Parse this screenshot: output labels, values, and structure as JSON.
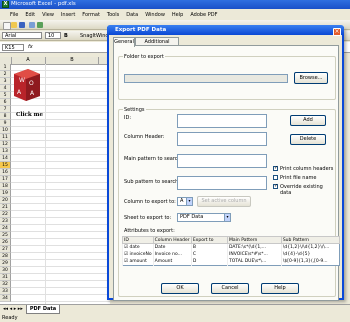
{
  "app": {
    "title": "Microsoft Excel - pdf.xls"
  },
  "menu": [
    "File",
    "Edit",
    "View",
    "Insert",
    "Format",
    "Tools",
    "Data",
    "Window",
    "Help",
    "Adobe PDF"
  ],
  "toolbar": {
    "font": "Arial",
    "size": "10",
    "snagit": "SnagIt",
    "window": "Window"
  },
  "namebox": "K15",
  "columns": [
    "A",
    "B"
  ],
  "rows": [
    "1",
    "2",
    "3",
    "4",
    "5",
    "6",
    "7",
    "8",
    "9",
    "10",
    "11",
    "12",
    "13",
    "14",
    "15",
    "16",
    "17",
    "18",
    "19",
    "20",
    "21",
    "22",
    "23",
    "24",
    "25",
    "26",
    "27",
    "28",
    "29",
    "30",
    "31",
    "32",
    "33",
    "34"
  ],
  "logo": {
    "letters": [
      "W",
      "O",
      "A",
      "A"
    ]
  },
  "clickme": "Click me",
  "sheet_tab": "PDF Data",
  "status": "Ready",
  "dialog": {
    "title": "Export PDF Data",
    "tabs": [
      "General",
      "Additional Patterns"
    ],
    "folder_group": "Folder to export",
    "browse": "Browse...",
    "settings_group": "Settings",
    "id_label": "ID:",
    "add": "Add",
    "col_header_label": "Column Header:",
    "delete": "Delete",
    "main_pattern_label": "Main pattern to search:",
    "sub_pattern_label": "Sub pattern to search:",
    "print_column_headers": "Print column headers",
    "print_file_name": "Print file name",
    "override_existing": "Override existing data",
    "column_to_export_label": "Column to export to:",
    "column_value": "A",
    "set_active_column": "Set active column",
    "sheet_to_export_label": "Sheet to export to:",
    "sheet_value": "PDF Data",
    "attributes_label": "Attributes to export:",
    "table_headers": [
      "ID",
      "Column Header",
      "Export to",
      "Main Pattern",
      "Sub Pattern"
    ],
    "rows": [
      {
        "id": "date",
        "header": "Date",
        "export": "B",
        "main": "DATE:\\s*(\\d{1,...",
        "sub": "\\d{1,2}\\/\\d{1,2}\\/\\..."
      },
      {
        "id": "invoiceNo",
        "header": "Invoice no...",
        "export": "C",
        "main": "INVOICE\\s*#\\s*...",
        "sub": "\\d{4}-\\d{5}"
      },
      {
        "id": "amount",
        "header": "Amount",
        "export": "D",
        "main": "TOTAL DUE\\s*\\...",
        "sub": "\\$[0-9]{1,3}(,[0-9..."
      }
    ],
    "ok": "OK",
    "cancel": "Cancel",
    "help": "Help"
  },
  "colors": {
    "titlebar": "#1a50c8",
    "dialog_border": "#0a49d8",
    "logo_red": "#c0282a"
  }
}
